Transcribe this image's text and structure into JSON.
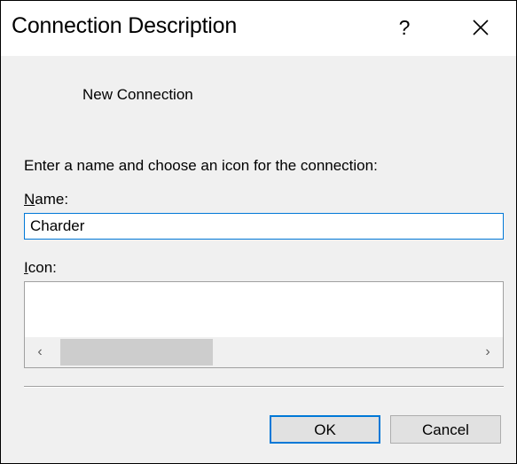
{
  "window": {
    "title": "Connection Description",
    "help_glyph": "?",
    "close_icon": "close-icon"
  },
  "header": {
    "connection_label": "New Connection"
  },
  "form": {
    "instructions": "Enter a name and choose an icon for the connection:",
    "name_label_accel": "N",
    "name_label_rest": "ame:",
    "name_value": "Charder",
    "icon_label_accel": "I",
    "icon_label_rest": "con:"
  },
  "scrollbar": {
    "left_glyph": "‹",
    "right_glyph": "›"
  },
  "buttons": {
    "ok": "OK",
    "cancel": "Cancel"
  },
  "colors": {
    "accent": "#0078d7",
    "dialog_bg": "#f0f0f0"
  }
}
